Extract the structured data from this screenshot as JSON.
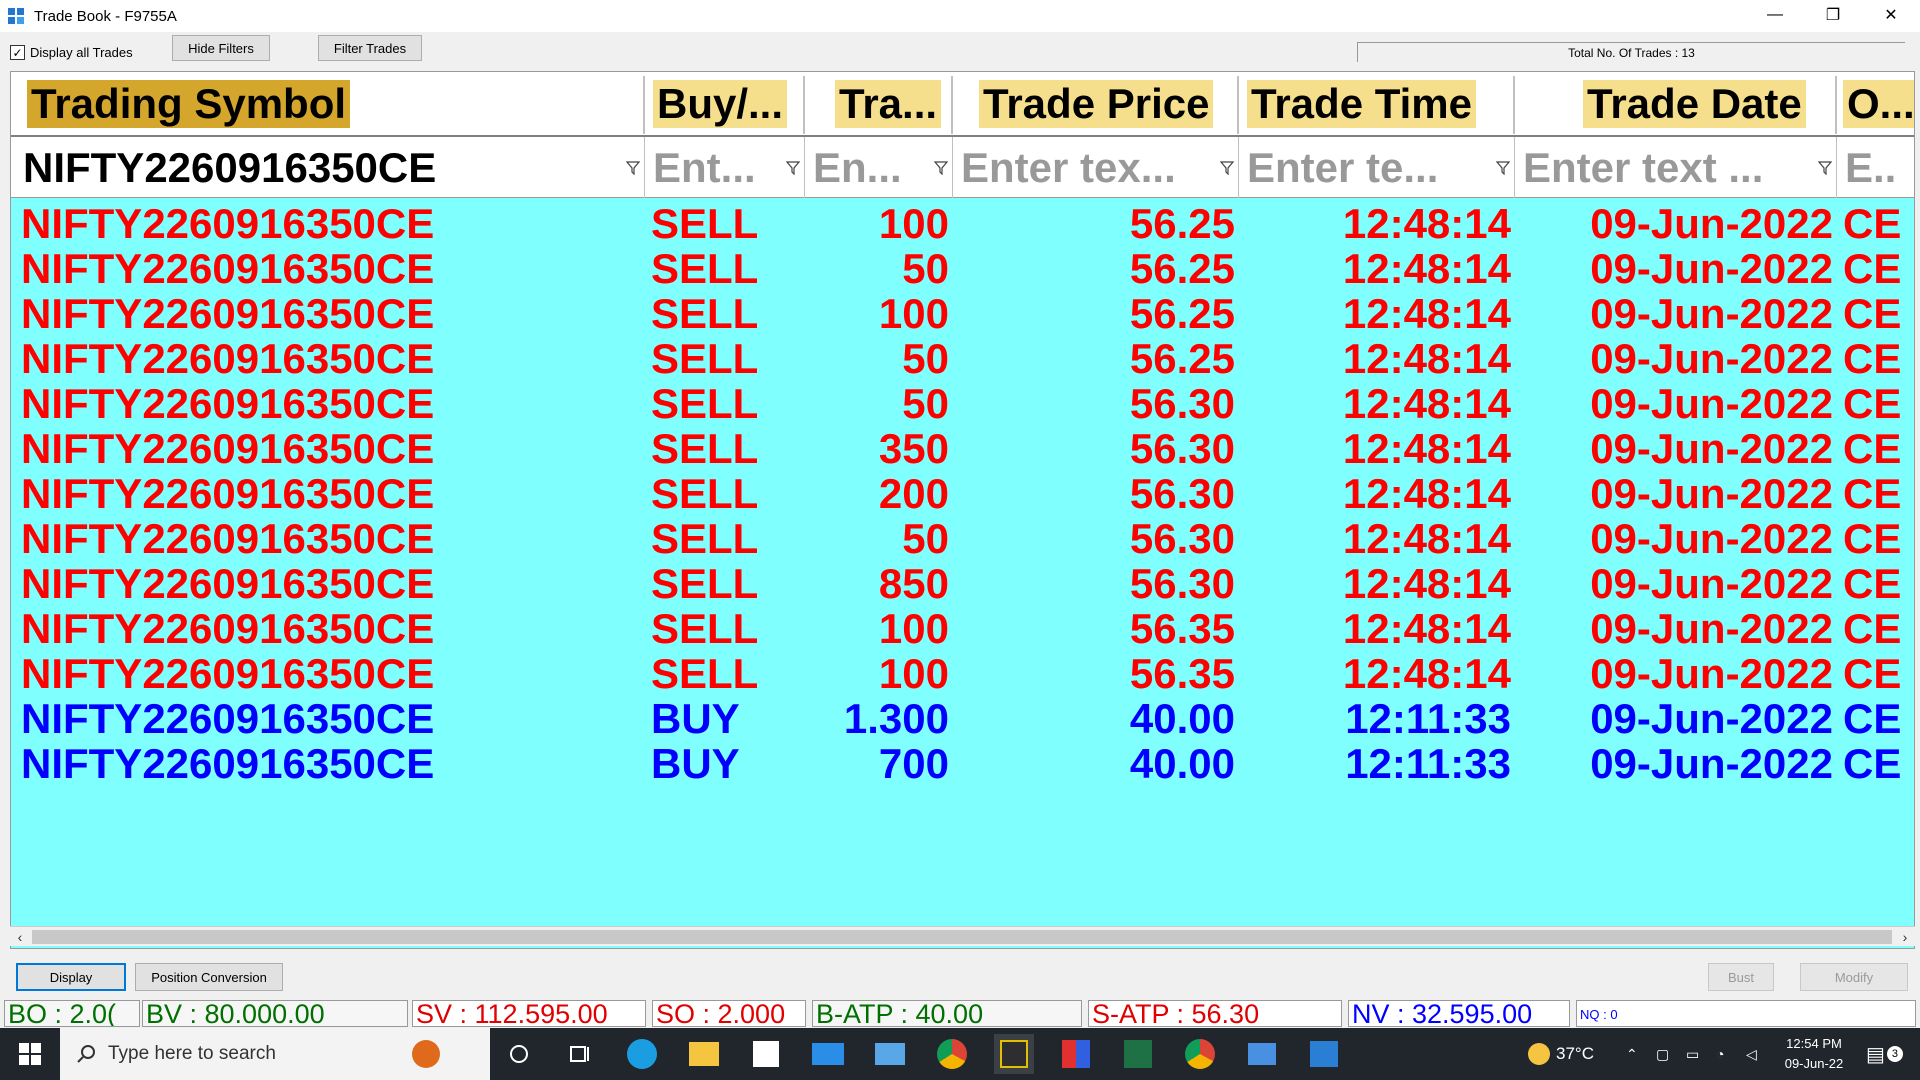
{
  "window": {
    "title": "Trade Book - F9755A",
    "minimize": "—",
    "restore": "❐",
    "close": "✕"
  },
  "toolbar": {
    "display_all_label": "Display all Trades",
    "display_all_checked": "✓",
    "hide_filters": "Hide Filters",
    "filter_trades": "Filter Trades",
    "total_trades": "Total No. Of Trades : 13"
  },
  "grid": {
    "columns": [
      {
        "header": "Trading Symbol",
        "filter": "NIFTY2260916350CE"
      },
      {
        "header": "Buy/...",
        "filter": "Ent..."
      },
      {
        "header": "Tra...",
        "filter": "En..."
      },
      {
        "header": "Trade Price",
        "filter": "Enter tex..."
      },
      {
        "header": "Trade Time",
        "filter": "Enter te..."
      },
      {
        "header": "Trade Date",
        "filter": "Enter text ..."
      },
      {
        "header": "O...",
        "filter": "E..."
      }
    ],
    "rows": [
      {
        "symbol": "NIFTY2260916350CE",
        "side": "SELL",
        "qty": "100",
        "price": "56.25",
        "time": "12:48:14",
        "date": "09-Jun-2022",
        "opt": "CE"
      },
      {
        "symbol": "NIFTY2260916350CE",
        "side": "SELL",
        "qty": "50",
        "price": "56.25",
        "time": "12:48:14",
        "date": "09-Jun-2022",
        "opt": "CE"
      },
      {
        "symbol": "NIFTY2260916350CE",
        "side": "SELL",
        "qty": "100",
        "price": "56.25",
        "time": "12:48:14",
        "date": "09-Jun-2022",
        "opt": "CE"
      },
      {
        "symbol": "NIFTY2260916350CE",
        "side": "SELL",
        "qty": "50",
        "price": "56.25",
        "time": "12:48:14",
        "date": "09-Jun-2022",
        "opt": "CE"
      },
      {
        "symbol": "NIFTY2260916350CE",
        "side": "SELL",
        "qty": "50",
        "price": "56.30",
        "time": "12:48:14",
        "date": "09-Jun-2022",
        "opt": "CE"
      },
      {
        "symbol": "NIFTY2260916350CE",
        "side": "SELL",
        "qty": "350",
        "price": "56.30",
        "time": "12:48:14",
        "date": "09-Jun-2022",
        "opt": "CE"
      },
      {
        "symbol": "NIFTY2260916350CE",
        "side": "SELL",
        "qty": "200",
        "price": "56.30",
        "time": "12:48:14",
        "date": "09-Jun-2022",
        "opt": "CE"
      },
      {
        "symbol": "NIFTY2260916350CE",
        "side": "SELL",
        "qty": "50",
        "price": "56.30",
        "time": "12:48:14",
        "date": "09-Jun-2022",
        "opt": "CE"
      },
      {
        "symbol": "NIFTY2260916350CE",
        "side": "SELL",
        "qty": "850",
        "price": "56.30",
        "time": "12:48:14",
        "date": "09-Jun-2022",
        "opt": "CE"
      },
      {
        "symbol": "NIFTY2260916350CE",
        "side": "SELL",
        "qty": "100",
        "price": "56.35",
        "time": "12:48:14",
        "date": "09-Jun-2022",
        "opt": "CE"
      },
      {
        "symbol": "NIFTY2260916350CE",
        "side": "SELL",
        "qty": "100",
        "price": "56.35",
        "time": "12:48:14",
        "date": "09-Jun-2022",
        "opt": "CE"
      },
      {
        "symbol": "NIFTY2260916350CE",
        "side": "BUY",
        "qty": "1.300",
        "price": "40.00",
        "time": "12:11:33",
        "date": "09-Jun-2022",
        "opt": "CE"
      },
      {
        "symbol": "NIFTY2260916350CE",
        "side": "BUY",
        "qty": "700",
        "price": "40.00",
        "time": "12:11:33",
        "date": "09-Jun-2022",
        "opt": "CE"
      }
    ],
    "colors": {
      "sell": "#ff0000",
      "buy": "#0000ff",
      "grid_bg": "#80ffff",
      "header_bg": "#f5df8c"
    }
  },
  "bottom": {
    "display": "Display",
    "position_conversion": "Position Conversion",
    "bust": "Bust",
    "modify": "Modify"
  },
  "status": {
    "bo": "BO : 2.0(",
    "bv": "BV : 80.000.00",
    "sv": "SV : 112.595.00",
    "so": "SO : 2.000",
    "batp": "B-ATP : 40.00",
    "satp": "S-ATP : 56.30",
    "nv": "NV : 32.595.00",
    "nq": "NQ : 0"
  },
  "taskbar": {
    "search_placeholder": "Type here to search",
    "temperature": "37°C",
    "time": "12:54 PM",
    "date": "09-Jun-22",
    "notification_count": "3"
  }
}
